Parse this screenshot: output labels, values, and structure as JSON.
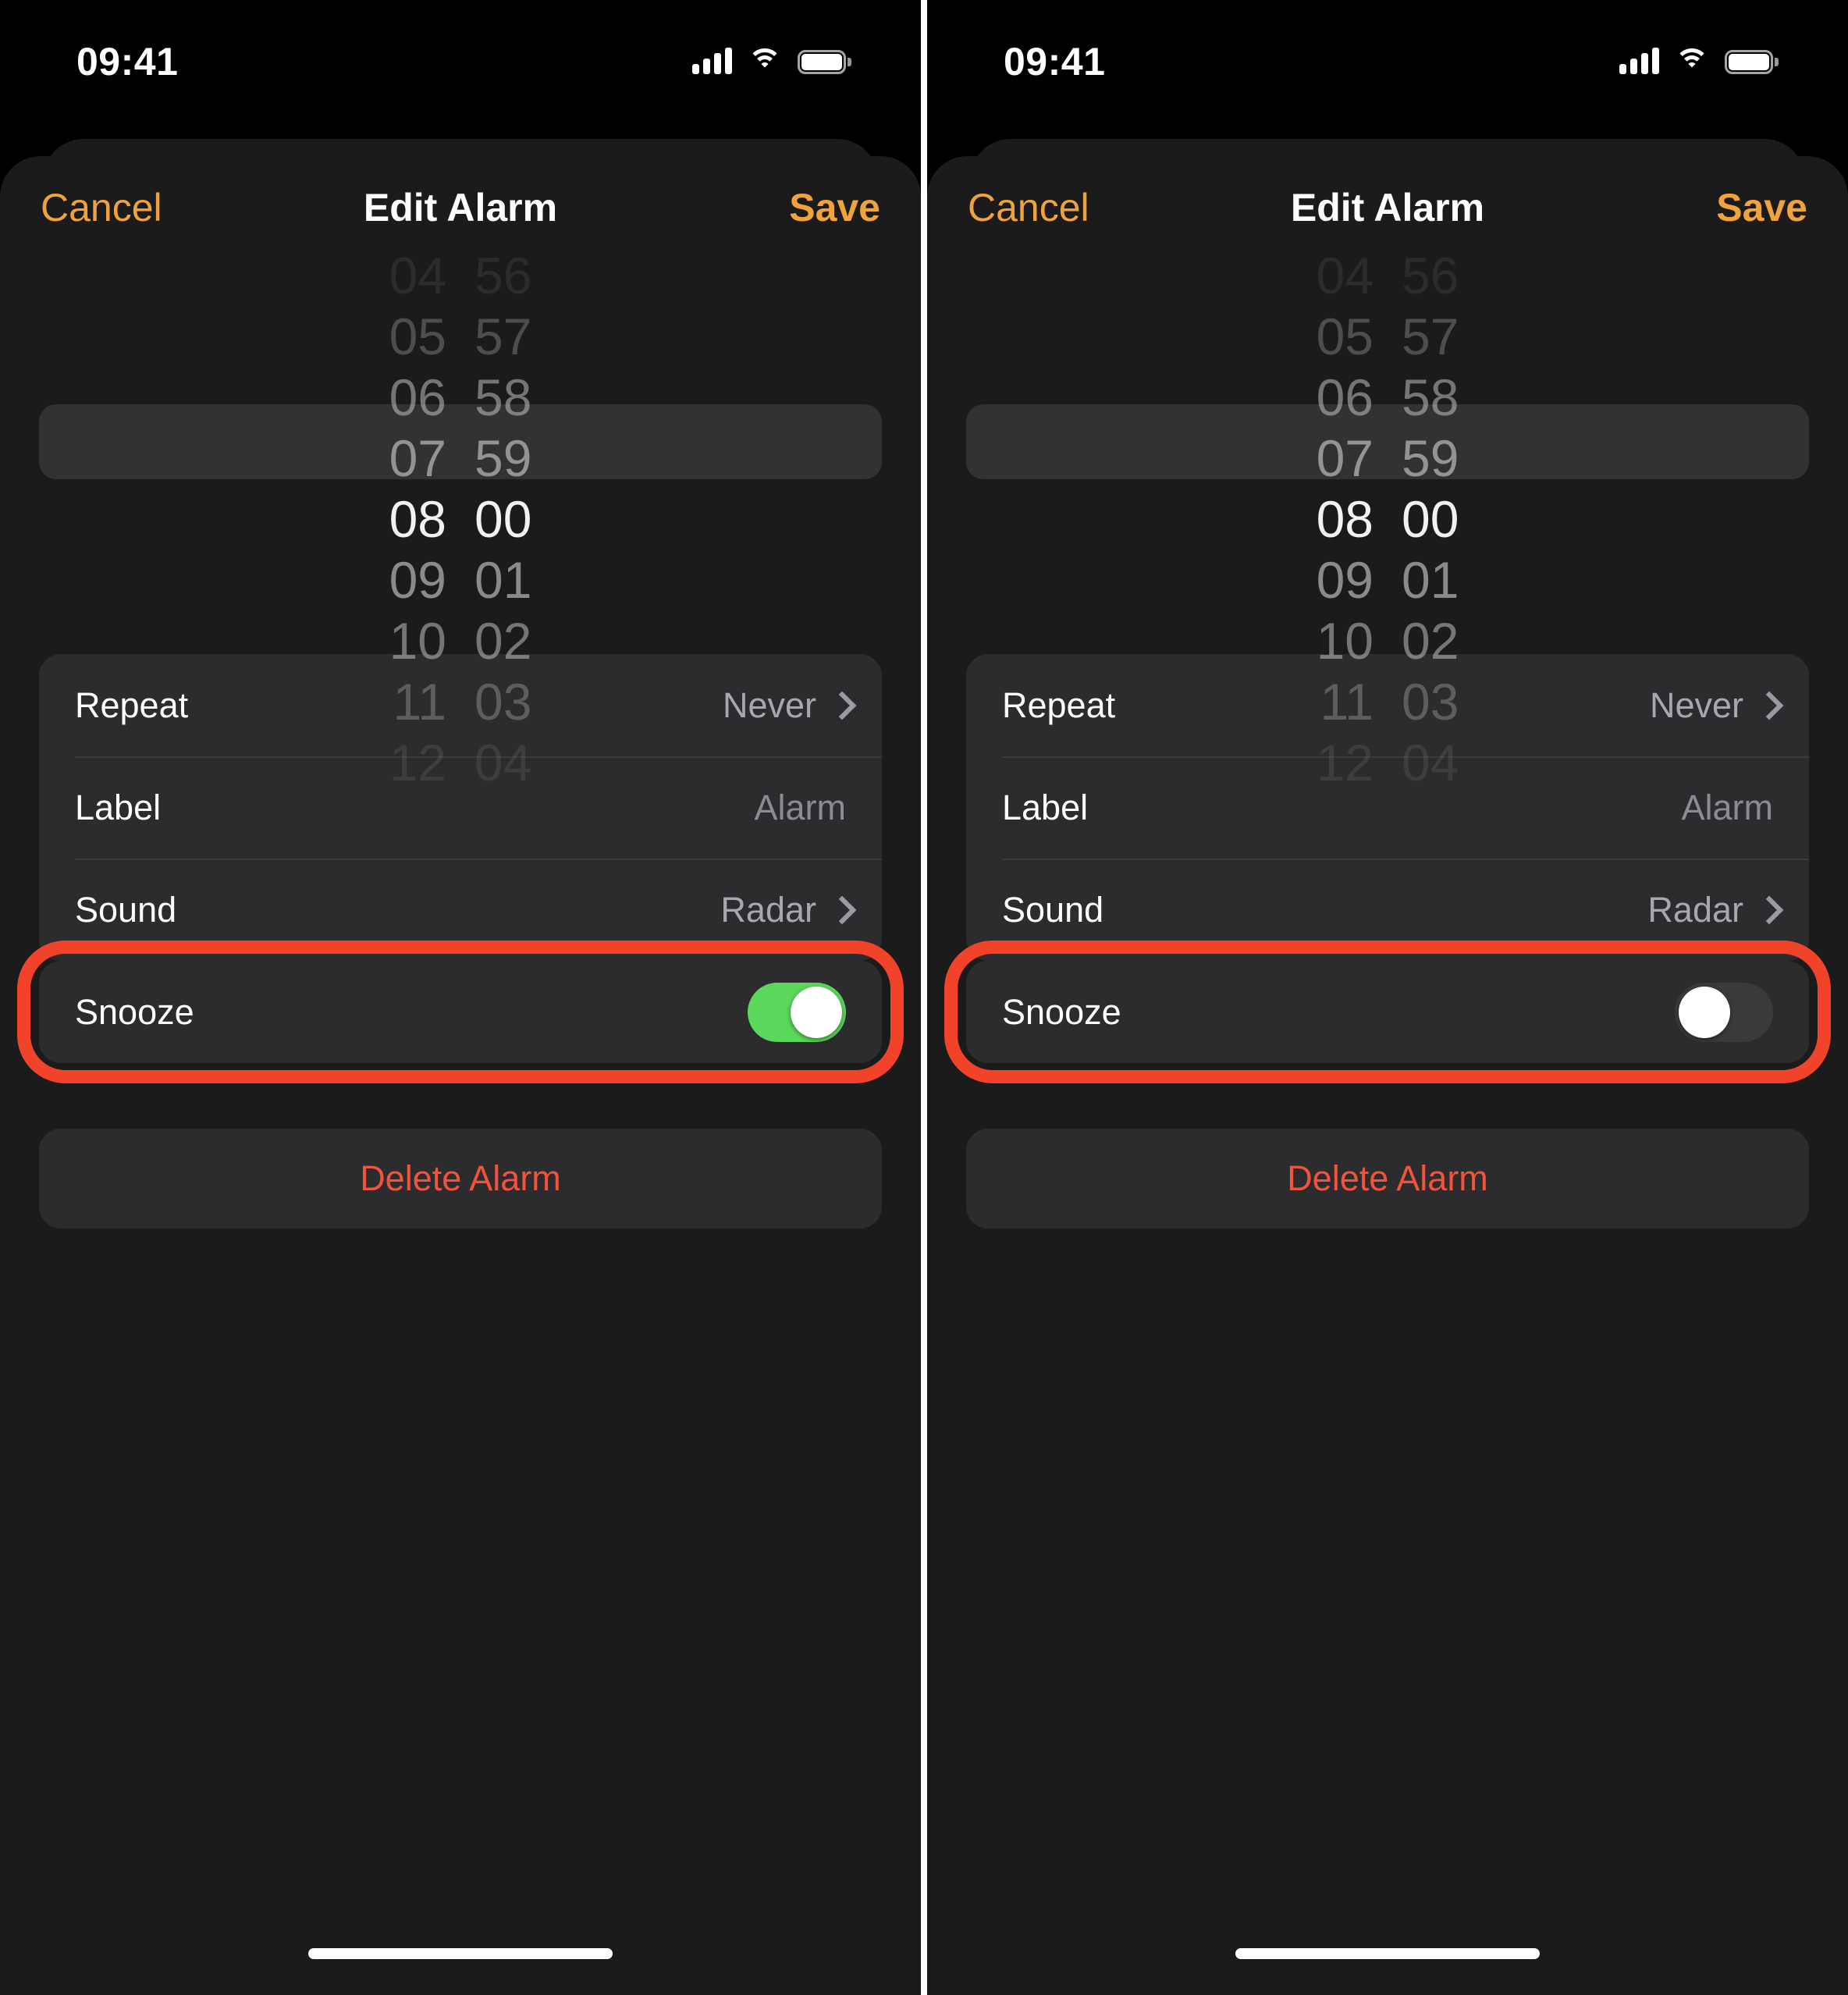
{
  "status_bar": {
    "time": "09:41",
    "icons": {
      "signal": "cellular-signal-icon",
      "wifi": "wifi-icon",
      "battery": "battery-full-icon"
    }
  },
  "nav": {
    "cancel_label": "Cancel",
    "title": "Edit Alarm",
    "save_label": "Save"
  },
  "picker": {
    "hours": [
      "04",
      "05",
      "06",
      "07",
      "08",
      "09",
      "10",
      "11",
      "12"
    ],
    "minutes": [
      "56",
      "57",
      "58",
      "59",
      "00",
      "01",
      "02",
      "03",
      "04"
    ],
    "selected_hour": "08",
    "selected_minute": "00"
  },
  "settings": {
    "rows": [
      {
        "label": "Repeat",
        "value": "Never",
        "chevron": true,
        "dim": false
      },
      {
        "label": "Label",
        "value": "Alarm",
        "chevron": false,
        "dim": true
      },
      {
        "label": "Sound",
        "value": "Radar",
        "chevron": true,
        "dim": false
      }
    ]
  },
  "snooze": {
    "label": "Snooze",
    "state_left": "on",
    "state_right": "off"
  },
  "delete": {
    "label": "Delete Alarm"
  },
  "colors": {
    "accent_orange": "#F0A23C",
    "destructive_red": "#F1543A",
    "annotation_red": "#F0432A",
    "toggle_on_green": "#5BD75B",
    "sheet_background": "#1b1b1b",
    "card_background": "#2c2c2e",
    "picker_highlight": "#323234"
  }
}
